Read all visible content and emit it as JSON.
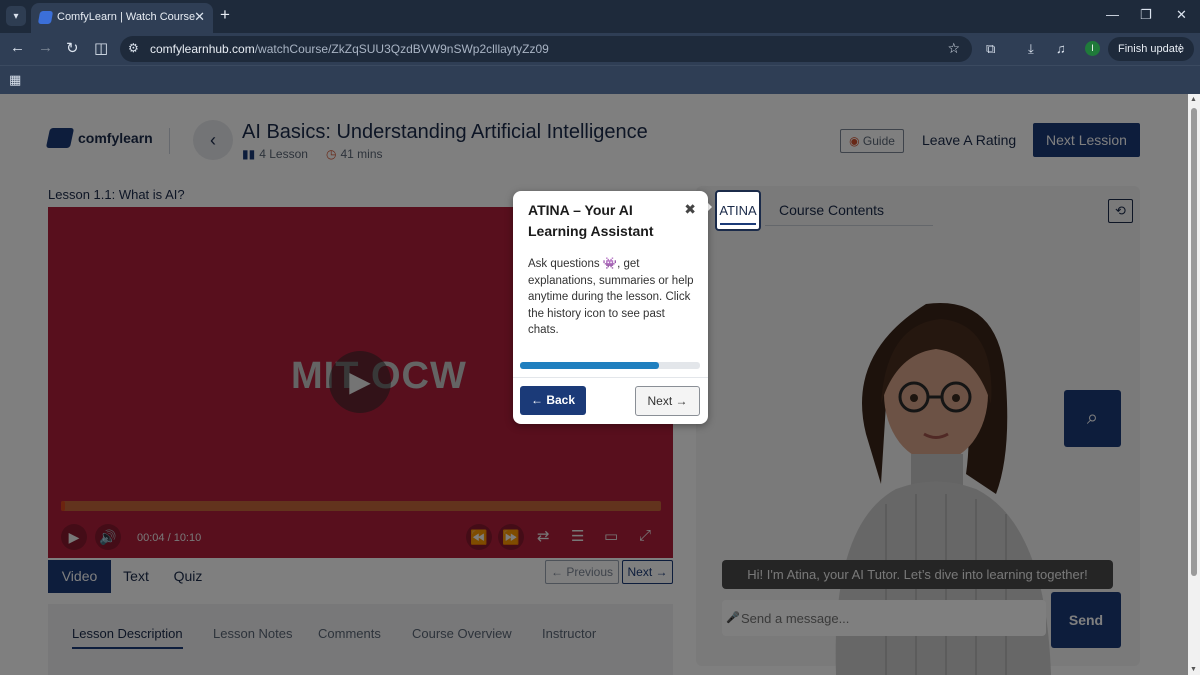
{
  "browser": {
    "tab_title": "ComfyLearn | Watch Course",
    "url_domain": "comfylearnhub.com",
    "url_path": "/watchCourse/ZkZqSUU3QzdBVW9nSWp2clllaytyZz09",
    "profile_initial": "I",
    "finish_update": "Finish update"
  },
  "header": {
    "logo": "comfylearn",
    "course_title": "AI Basics: Understanding Artificial Intelligence",
    "lessons": "4 Lesson",
    "duration": "41 mins",
    "guide": "Guide",
    "leave_rating": "Leave A Rating",
    "next_lesson": "Next Lession"
  },
  "lesson": {
    "label": "Lesson 1.1: What is AI?",
    "video_brand": "MIT OCW",
    "time": "00:04 / 10:10",
    "progress_fraction": 0.007
  },
  "content_tabs": [
    "Video",
    "Text",
    "Quiz"
  ],
  "pager": {
    "previous": "← Previous",
    "next": "Next →"
  },
  "description_tabs": [
    "Lesson Description",
    "Lesson Notes",
    "Comments",
    "Course Overview",
    "Instructor"
  ],
  "panel": {
    "tab_atina": "ATINA",
    "tab_contents": "Course Contents",
    "greeting": "Hi! I'm Atina, your AI Tutor. Let’s dive into learning together!",
    "message_placeholder": "Send a message...",
    "send": "Send"
  },
  "tour": {
    "title": "ATINA – Your AI Learning Assistant",
    "body": "Ask questions 👾, get explanations, summaries or help anytime during the lesson. Click the history icon to see past chats.",
    "step_fraction": 0.77,
    "back": "← Back",
    "next": "Next →"
  },
  "colors": {
    "brand": "#1b3a78",
    "video_bg": "#b01f3b",
    "progress": "#1f7fbf"
  }
}
